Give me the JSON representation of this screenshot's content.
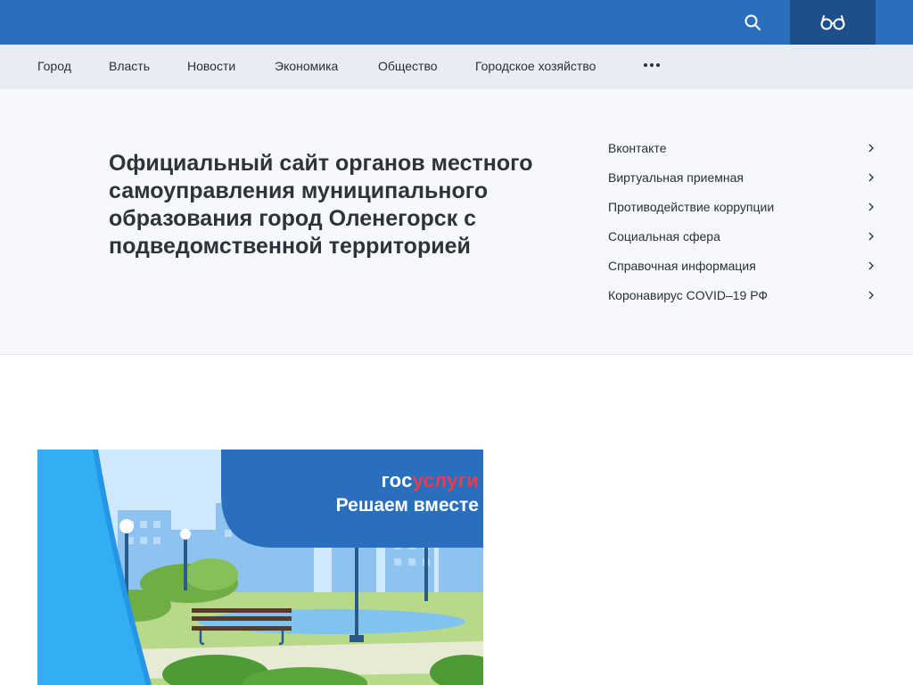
{
  "header": {
    "search_icon": "search-icon",
    "accessibility_icon": "glasses-icon"
  },
  "nav": {
    "items": [
      {
        "label": "Город"
      },
      {
        "label": "Власть"
      },
      {
        "label": "Новости"
      },
      {
        "label": "Экономика"
      },
      {
        "label": "Общество"
      },
      {
        "label": "Городское хозяйство"
      }
    ],
    "more_icon": "more-dots-icon"
  },
  "hero": {
    "title": "Официальный сайт органов местного самоуправления муниципального образования город Оленегорск с подведомственной территорией"
  },
  "quick_links": [
    {
      "label": "Вконтакте"
    },
    {
      "label": "Виртуальная приемная"
    },
    {
      "label": "Противодействие коррупции"
    },
    {
      "label": "Социальная сфера"
    },
    {
      "label": "Справочная информация"
    },
    {
      "label": "Коронавирус COVID–19 РФ"
    }
  ],
  "banner": {
    "brand_part1": "гос",
    "brand_part2": "услуги",
    "tagline": "Решаем вместе"
  },
  "colors": {
    "topbar": "#2a6fbd",
    "accessibility_button": "#1d4f8a",
    "navbar": "#e8edf3",
    "hero_background": "#f6f8fb",
    "brand_red": "#ef3b4e"
  }
}
